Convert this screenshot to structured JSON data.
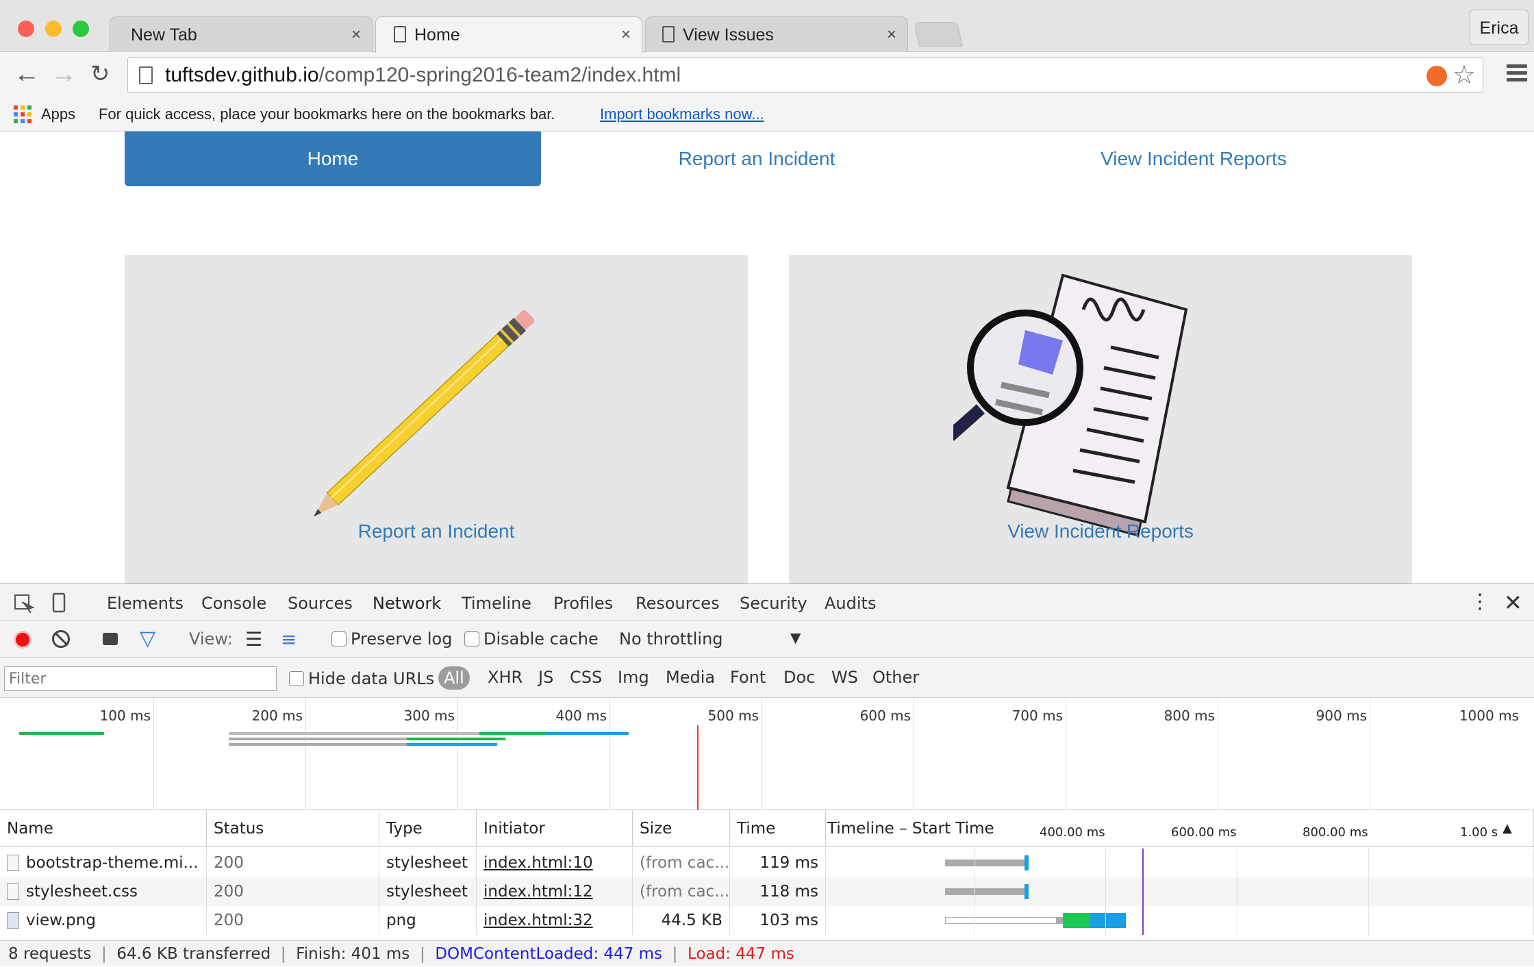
{
  "browser": {
    "tabs": [
      {
        "label": "New Tab",
        "close": "×"
      },
      {
        "label": "Home",
        "close": "×"
      },
      {
        "label": "View Issues",
        "close": "×"
      }
    ],
    "profile": "Erica",
    "url_host": "tuftsdev.github.io",
    "url_path": "/comp120-spring2016-team2/index.html",
    "bookmarks": {
      "apps": "Apps",
      "hint": "For quick access, place your bookmarks here on the bookmarks bar.",
      "import": "Import bookmarks now..."
    }
  },
  "page": {
    "nav": [
      "Home",
      "Report an Incident",
      "View Incident Reports"
    ],
    "cards": [
      {
        "caption": "Report an Incident",
        "icon": "pencil-icon"
      },
      {
        "caption": "View Incident Reports",
        "icon": "magnifier-document-icon"
      }
    ],
    "colors": {
      "primary": "#337ab7",
      "card_bg": "#e6e6e6"
    }
  },
  "devtools": {
    "tabs": [
      "Elements",
      "Console",
      "Sources",
      "Network",
      "Timeline",
      "Profiles",
      "Resources",
      "Security",
      "Audits"
    ],
    "active_tab": "Network",
    "toolbar": {
      "view_label": "View:",
      "preserve_log": "Preserve log",
      "disable_cache": "Disable cache",
      "throttling": "No throttling"
    },
    "filter": {
      "placeholder": "Filter",
      "hide_data_urls": "Hide data URLs",
      "types": [
        "All",
        "XHR",
        "JS",
        "CSS",
        "Img",
        "Media",
        "Font",
        "Doc",
        "WS",
        "Other"
      ],
      "active_type": "All"
    },
    "overview_labels": [
      "100 ms",
      "200 ms",
      "300 ms",
      "400 ms",
      "500 ms",
      "600 ms",
      "700 ms",
      "800 ms",
      "900 ms",
      "1000 ms"
    ],
    "columns": [
      "Name",
      "Status",
      "Type",
      "Initiator",
      "Size",
      "Time",
      "Timeline – Start Time"
    ],
    "timeline_labels": [
      "400.00 ms",
      "600.00 ms",
      "800.00 ms",
      "1.00 s"
    ],
    "rows": [
      {
        "name": "bootstrap-theme.mi...",
        "status": "200",
        "type": "stylesheet",
        "initiator": "index.html:10",
        "size": "(from cac...",
        "time": "119 ms"
      },
      {
        "name": "stylesheet.css",
        "status": "200",
        "type": "stylesheet",
        "initiator": "index.html:12",
        "size": "(from cac...",
        "time": "118 ms"
      },
      {
        "name": "view.png",
        "status": "200",
        "type": "png",
        "initiator": "index.html:32",
        "size": "44.5 KB",
        "time": "103 ms"
      }
    ],
    "summary": {
      "requests": "8 requests",
      "transferred": "64.6 KB transferred",
      "finish": "Finish: 401 ms",
      "dcl": "DOMContentLoaded: 447 ms",
      "load": "Load: 447 ms"
    }
  }
}
